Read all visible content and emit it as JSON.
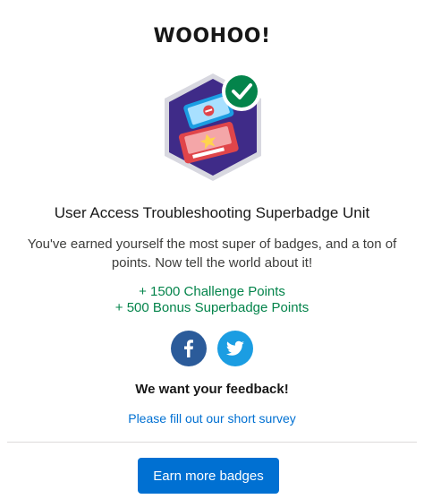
{
  "modal": {
    "heading": "WOOHOO!",
    "badge_title": "User Access Troubleshooting Superbadge Unit",
    "message": "You've earned yourself the most super of badges, and a ton of points. Now tell the world about it!",
    "points": [
      "+ 1500 Challenge Points",
      "+ 500 Bonus Superbadge Points"
    ],
    "feedback_heading": "We want your feedback!",
    "survey_link": "Please fill out our short survey",
    "cta_label": "Earn more badges"
  },
  "social": {
    "facebook_icon": "facebook-icon",
    "twitter_icon": "twitter-icon"
  },
  "colors": {
    "points_green": "#04844b",
    "link_blue": "#0070d2",
    "button_blue": "#0070d2",
    "facebook_blue": "#2b5b9a",
    "twitter_blue": "#1b9de2",
    "badge_purple": "#3f2b88",
    "check_green": "#04844b"
  }
}
